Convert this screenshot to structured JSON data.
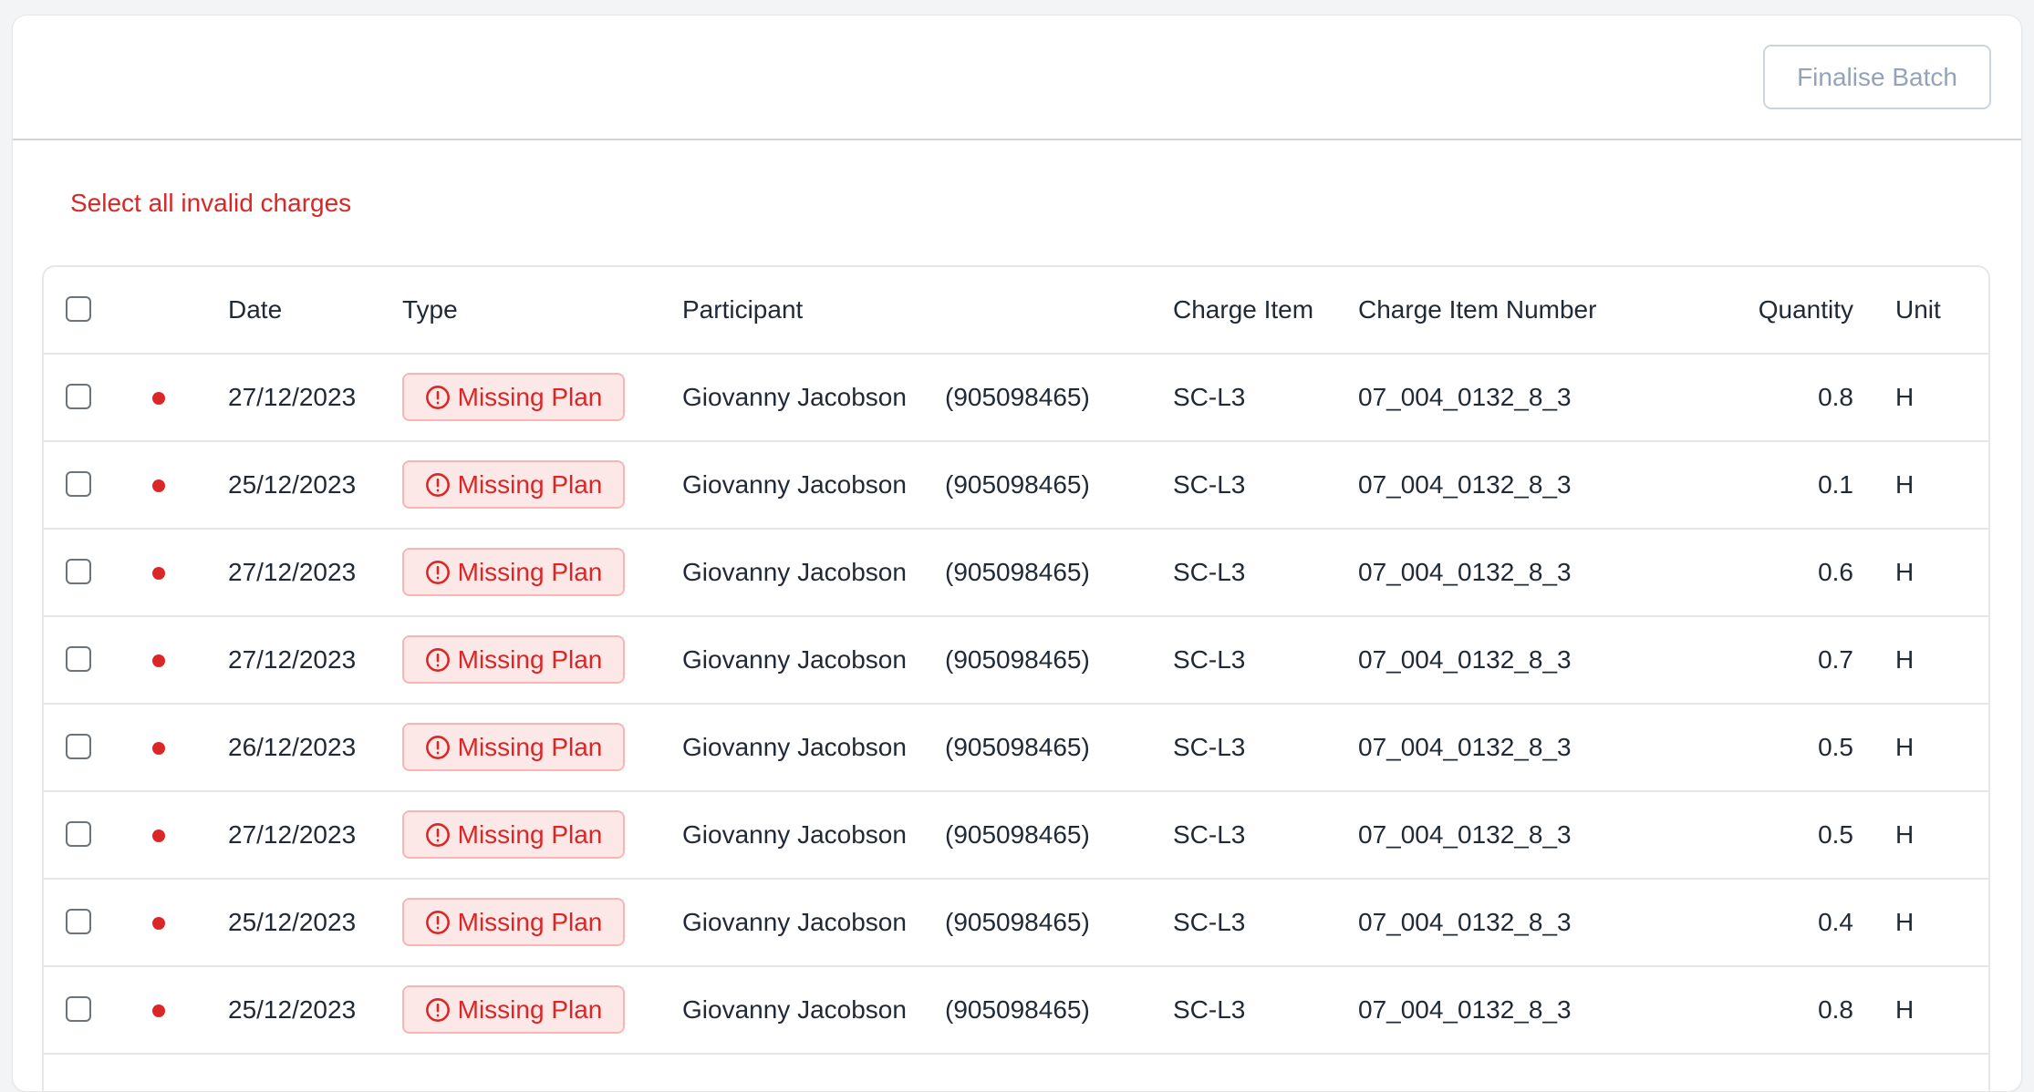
{
  "toolbar": {
    "finalise_label": "Finalise Batch"
  },
  "select_all_invalid_label": "Select all invalid charges",
  "table": {
    "columns": {
      "date": "Date",
      "type": "Type",
      "participant": "Participant",
      "charge_item": "Charge Item",
      "charge_item_number": "Charge Item Number",
      "quantity": "Quantity",
      "unit": "Unit"
    },
    "rows": [
      {
        "date": "27/12/2023",
        "type": "Missing Plan",
        "participant": "Giovanny Jacobson",
        "participant_id": "(905098465)",
        "charge_item": "SC-L3",
        "charge_item_number": "07_004_0132_8_3",
        "quantity": "0.8",
        "unit": "H"
      },
      {
        "date": "25/12/2023",
        "type": "Missing Plan",
        "participant": "Giovanny Jacobson",
        "participant_id": "(905098465)",
        "charge_item": "SC-L3",
        "charge_item_number": "07_004_0132_8_3",
        "quantity": "0.1",
        "unit": "H"
      },
      {
        "date": "27/12/2023",
        "type": "Missing Plan",
        "participant": "Giovanny Jacobson",
        "participant_id": "(905098465)",
        "charge_item": "SC-L3",
        "charge_item_number": "07_004_0132_8_3",
        "quantity": "0.6",
        "unit": "H"
      },
      {
        "date": "27/12/2023",
        "type": "Missing Plan",
        "participant": "Giovanny Jacobson",
        "participant_id": "(905098465)",
        "charge_item": "SC-L3",
        "charge_item_number": "07_004_0132_8_3",
        "quantity": "0.7",
        "unit": "H"
      },
      {
        "date": "26/12/2023",
        "type": "Missing Plan",
        "participant": "Giovanny Jacobson",
        "participant_id": "(905098465)",
        "charge_item": "SC-L3",
        "charge_item_number": "07_004_0132_8_3",
        "quantity": "0.5",
        "unit": "H"
      },
      {
        "date": "27/12/2023",
        "type": "Missing Plan",
        "participant": "Giovanny Jacobson",
        "participant_id": "(905098465)",
        "charge_item": "SC-L3",
        "charge_item_number": "07_004_0132_8_3",
        "quantity": "0.5",
        "unit": "H"
      },
      {
        "date": "25/12/2023",
        "type": "Missing Plan",
        "participant": "Giovanny Jacobson",
        "participant_id": "(905098465)",
        "charge_item": "SC-L3",
        "charge_item_number": "07_004_0132_8_3",
        "quantity": "0.4",
        "unit": "H"
      },
      {
        "date": "25/12/2023",
        "type": "Missing Plan",
        "participant": "Giovanny Jacobson",
        "participant_id": "(905098465)",
        "charge_item": "SC-L3",
        "charge_item_number": "07_004_0132_8_3",
        "quantity": "0.8",
        "unit": "H"
      }
    ]
  },
  "colors": {
    "error": "#dc2626",
    "badge_bg": "#fde8e8",
    "badge_border": "#f9b4b4"
  },
  "icons": {
    "status_dot": "red-dot-icon",
    "badge_icon": "alert-circle-icon"
  }
}
